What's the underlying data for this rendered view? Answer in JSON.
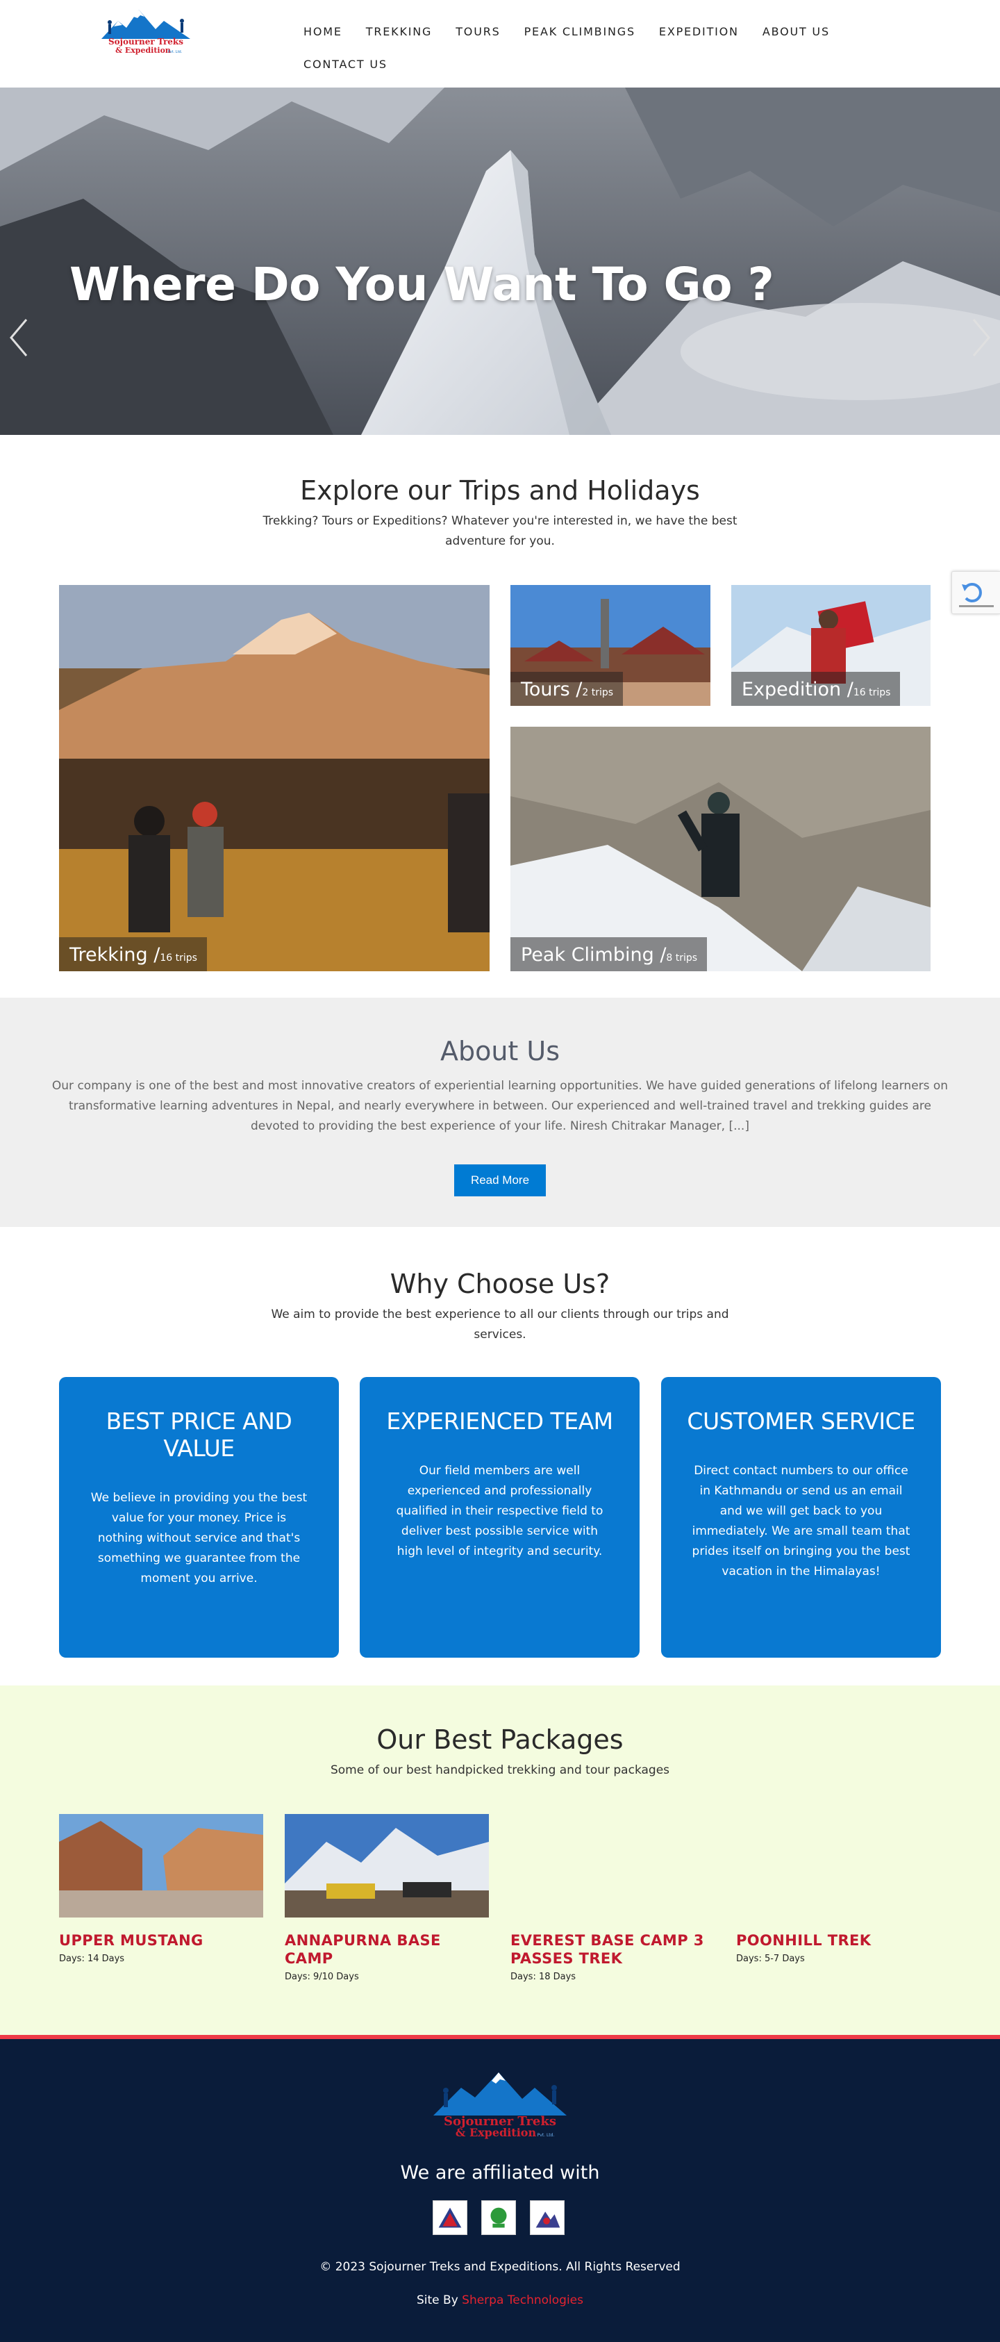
{
  "nav": {
    "items": [
      "HOME",
      "TREKKING",
      "TOURS",
      "PEAK CLIMBINGS",
      "EXPEDITION",
      "ABOUT US"
    ],
    "contact": "CONTACT US"
  },
  "logo": {
    "line1": "Sojourner Treks",
    "line2": "& Expedition",
    "suffix": "Pvt. Ltd."
  },
  "hero": {
    "title": "Where Do You Want To Go ?"
  },
  "explore": {
    "title": "Explore our Trips and Holidays",
    "subtitle": "Trekking? Tours or Expeditions? Whatever you're interested in, we have the best adventure for you.",
    "tiles": [
      {
        "name": "Trekking /",
        "count": "16 trips"
      },
      {
        "name": "Tours /",
        "count": "2 trips"
      },
      {
        "name": "Expedition /",
        "count": "16 trips"
      },
      {
        "name": "Peak Climbing /",
        "count": "8 trips"
      }
    ]
  },
  "about": {
    "title": "About Us",
    "text": "Our company is one of the best and most innovative creators of experiential learning opportunities. We have guided generations of lifelong learners on transformative learning adventures in Nepal, and nearly everywhere in between. Our experienced and well-trained travel and trekking guides are devoted to providing the best experience of your life.   Niresh Chitrakar Manager, [...]",
    "button": "Read More"
  },
  "why": {
    "title": "Why Choose Us?",
    "subtitle": "We aim to provide the best experience to all our clients through our trips and services.",
    "features": [
      {
        "title": "BEST PRICE AND VALUE",
        "text": "We believe in providing you the best value for your money. Price is nothing without service and that's something we guarantee from the moment you arrive."
      },
      {
        "title": "EXPERIENCED TEAM",
        "text": "Our field members are well experienced and professionally qualified in their respective field to deliver best possible service with high level of integrity and security."
      },
      {
        "title": "CUSTOMER SERVICE",
        "text": "Direct contact numbers to our office in Kathmandu or send us an email and we will get back to you immediately. We are small team that prides itself on bringing you the best vacation in the Himalayas!"
      }
    ]
  },
  "packages": {
    "title": "Our Best Packages",
    "subtitle": "Some of our best handpicked trekking and tour packages",
    "items": [
      {
        "name": "UPPER MUSTANG",
        "days": "Days: 14 Days"
      },
      {
        "name": "ANNAPURNA BASE CAMP",
        "days": "Days: 9/10 Days"
      },
      {
        "name": "EVEREST BASE CAMP 3 PASSES TREK",
        "days": "Days: 18 Days"
      },
      {
        "name": "POONHILL TREK",
        "days": "Days: 5-7 Days"
      }
    ]
  },
  "footer": {
    "affiliated": "We are affiliated with",
    "copyright": "© 2023 Sojourner Treks and Expeditions. All Rights Reserved",
    "site_by": "Site By",
    "site_by_link": "Sherpa Technologies"
  },
  "colors": {
    "primary_blue": "#0979d1",
    "brand_red": "#c0192e",
    "footer_bg": "#0a1c3a",
    "packages_bg": "#f4fcdf"
  }
}
